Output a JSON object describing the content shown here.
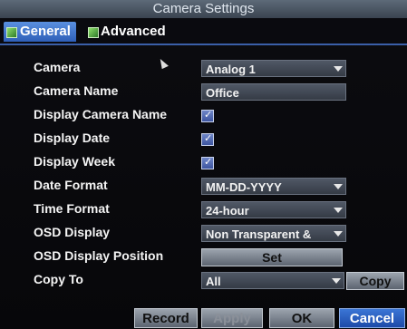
{
  "title": "Camera Settings",
  "tabs": [
    {
      "label": "General",
      "active": true
    },
    {
      "label": "Advanced",
      "active": false
    }
  ],
  "form": {
    "camera": {
      "label": "Camera",
      "value": "Analog 1"
    },
    "camera_name": {
      "label": "Camera Name",
      "value": "Office"
    },
    "display_camera_name": {
      "label": "Display Camera Name",
      "checked": true
    },
    "display_date": {
      "label": "Display Date",
      "checked": true
    },
    "display_week": {
      "label": "Display Week",
      "checked": true
    },
    "date_format": {
      "label": "Date Format",
      "value": "MM-DD-YYYY"
    },
    "time_format": {
      "label": "Time Format",
      "value": "24-hour"
    },
    "osd_display": {
      "label": "OSD Display",
      "value": "Non Transparent &"
    },
    "osd_display_position": {
      "label": "OSD Display Position",
      "button": "Set"
    },
    "copy_to": {
      "label": "Copy To",
      "value": "All",
      "button": "Copy"
    }
  },
  "footer": {
    "record": "Record",
    "apply": "Apply",
    "ok": "OK",
    "cancel": "Cancel"
  },
  "check_mark": "✓"
}
